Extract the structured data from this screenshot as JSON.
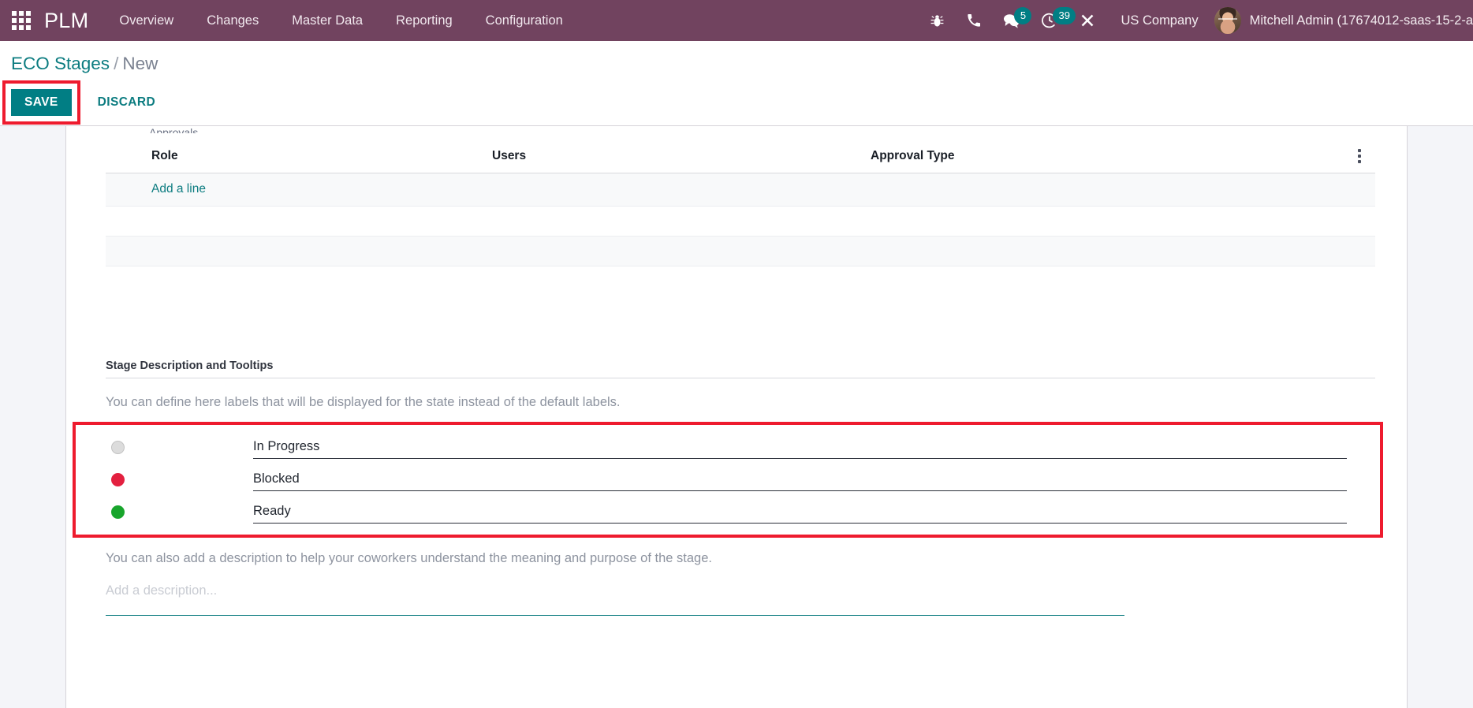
{
  "navbar": {
    "apps_icon": "apps-grid-icon",
    "brand": "PLM",
    "menu": [
      {
        "label": "Overview"
      },
      {
        "label": "Changes"
      },
      {
        "label": "Master Data"
      },
      {
        "label": "Reporting"
      },
      {
        "label": "Configuration"
      }
    ],
    "icons": [
      {
        "name": "bug-icon",
        "badge": null
      },
      {
        "name": "phone-icon",
        "badge": null
      },
      {
        "name": "messages-icon",
        "badge": "5"
      },
      {
        "name": "activities-clock-icon",
        "badge": "39"
      },
      {
        "name": "tools-icon",
        "badge": null
      }
    ],
    "company": "US Company",
    "username": "Mitchell Admin (17674012-saas-15-2-a"
  },
  "control_panel": {
    "breadcrumb_root": "ECO Stages",
    "breadcrumb_sep": "/",
    "breadcrumb_current": "New",
    "save_label": "SAVE",
    "discard_label": "DISCARD"
  },
  "approvals": {
    "columns": {
      "role": "Role",
      "users": "Users",
      "approval_type": "Approval Type"
    },
    "optional_columns_icon": "vertical-dots-icon",
    "add_line_label": "Add a line",
    "rows": []
  },
  "stage_description": {
    "section_title": "Stage Description and Tooltips",
    "help_text": "You can define here labels that will be displayed for the state instead of the default labels.",
    "states": [
      {
        "color_name": "grey",
        "color": "#dcdcdc",
        "value": "In Progress"
      },
      {
        "color_name": "red",
        "color": "#e3203f",
        "value": "Blocked"
      },
      {
        "color_name": "green",
        "color": "#18a52c",
        "value": "Ready"
      }
    ],
    "help_text2": "You can also add a description to help your coworkers understand the meaning and purpose of the stage.",
    "description_placeholder": "Add a description..."
  },
  "theme": {
    "navbar_bg": "#71435f",
    "accent_teal": "#017e84",
    "link_teal": "#0c7c80",
    "highlight_red": "#ee1b2e",
    "page_bg": "#f4f5f9"
  }
}
